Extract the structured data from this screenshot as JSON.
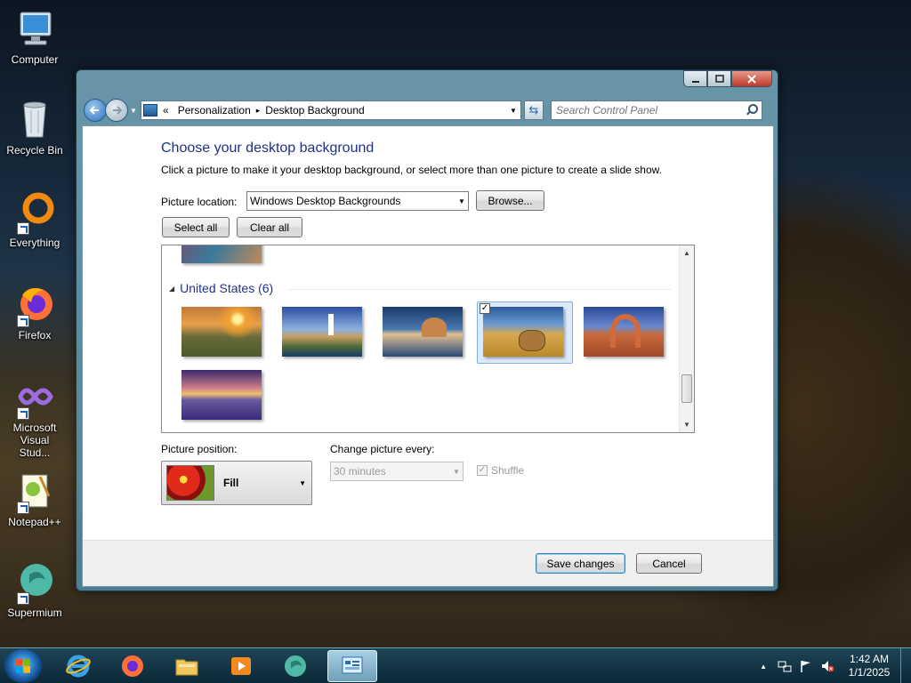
{
  "desktop": {
    "icons": [
      {
        "label": "Computer",
        "icon": "computer-icon"
      },
      {
        "label": "Recycle Bin",
        "icon": "recycle-bin-icon"
      },
      {
        "label": "Everything",
        "icon": "everything-icon"
      },
      {
        "label": "Firefox",
        "icon": "firefox-icon"
      },
      {
        "label": "Microsoft Visual Stud...",
        "icon": "visual-studio-icon"
      },
      {
        "label": "Notepad++",
        "icon": "notepadpp-icon"
      },
      {
        "label": "Supermium",
        "icon": "supermium-icon"
      }
    ]
  },
  "window": {
    "address": {
      "root": "«",
      "crumb1": "Personalization",
      "sep": "▸",
      "crumb2": "Desktop Background"
    },
    "search_placeholder": "Search Control Panel",
    "title": "Choose your desktop background",
    "description": "Click a picture to make it your desktop background, or select more than one picture to create a slide show.",
    "picture_location_label": "Picture location:",
    "picture_location_value": "Windows Desktop Backgrounds",
    "browse_label": "Browse...",
    "select_all_label": "Select all",
    "clear_all_label": "Clear all",
    "group_label": "United States (6)",
    "thumbnails": [
      {
        "name": "sunset-fields",
        "selected": false
      },
      {
        "name": "lighthouse-coast",
        "selected": false
      },
      {
        "name": "rock-lake",
        "selected": false
      },
      {
        "name": "hay-bale-field",
        "selected": true
      },
      {
        "name": "delicate-arch",
        "selected": false
      },
      {
        "name": "flower-valley-lake",
        "selected": false
      }
    ],
    "picture_position_label": "Picture position:",
    "picture_position_value": "Fill",
    "change_every_label": "Change picture every:",
    "change_every_value": "30 minutes",
    "shuffle_label": "Shuffle",
    "save_label": "Save changes",
    "cancel_label": "Cancel"
  },
  "taskbar": {
    "time": "1:42 AM",
    "date": "1/1/2025"
  },
  "colors": {
    "heading": "#1e3287",
    "selection": "#dcebfc",
    "window_frame": "#78aabe"
  }
}
